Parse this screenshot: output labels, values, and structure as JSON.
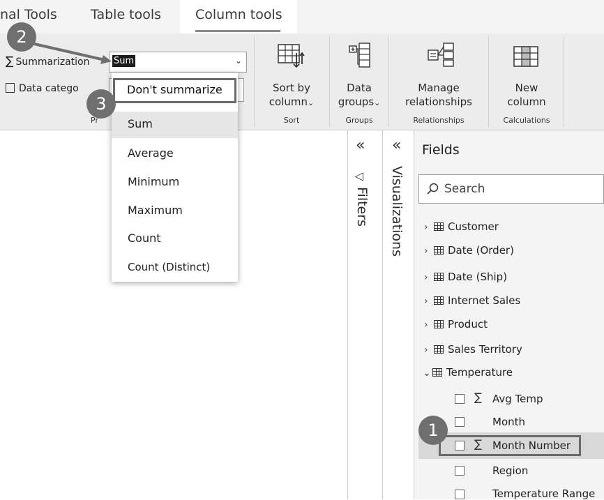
{
  "tabs": {
    "external": "nal Tools",
    "table": "Table tools",
    "column": "Column tools"
  },
  "properties": {
    "summarization_label": "Summarization",
    "summarization_value": "Sum",
    "datacategory_label": "Data catego",
    "group_label": "Pr"
  },
  "ribbon": {
    "sort_by": {
      "line1": "Sort by",
      "line2": "column",
      "group": "Sort"
    },
    "data_groups": {
      "line1": "Data",
      "line2": "groups",
      "group": "Groups"
    },
    "manage_rel": {
      "line1": "Manage",
      "line2": "relationships",
      "group": "Relationships"
    },
    "new_column": {
      "line1": "New",
      "line2": "column",
      "group": "Calculations"
    }
  },
  "dropdown": {
    "items": [
      "Don't summarize",
      "Sum",
      "Average",
      "Minimum",
      "Maximum",
      "Count",
      "Count (Distinct)"
    ]
  },
  "callouts": [
    "1",
    "2",
    "3"
  ],
  "panes": {
    "filters": "Filters",
    "visualizations": "Visualizations",
    "fields": "Fields",
    "collapse_glyph": "«"
  },
  "search": {
    "placeholder": "Search"
  },
  "tables": [
    "Customer",
    "Date (Order)",
    "Date (Ship)",
    "Internet Sales",
    "Product",
    "Sales Territory",
    "Temperature"
  ],
  "temperature_fields": [
    "Avg Temp",
    "Month",
    "Month Number",
    "Region",
    "Temperature Range"
  ],
  "colors": {
    "accent_gray": "#6f6f6f",
    "ribbon_bg": "#ececec",
    "selection": "#1c1c1c"
  }
}
